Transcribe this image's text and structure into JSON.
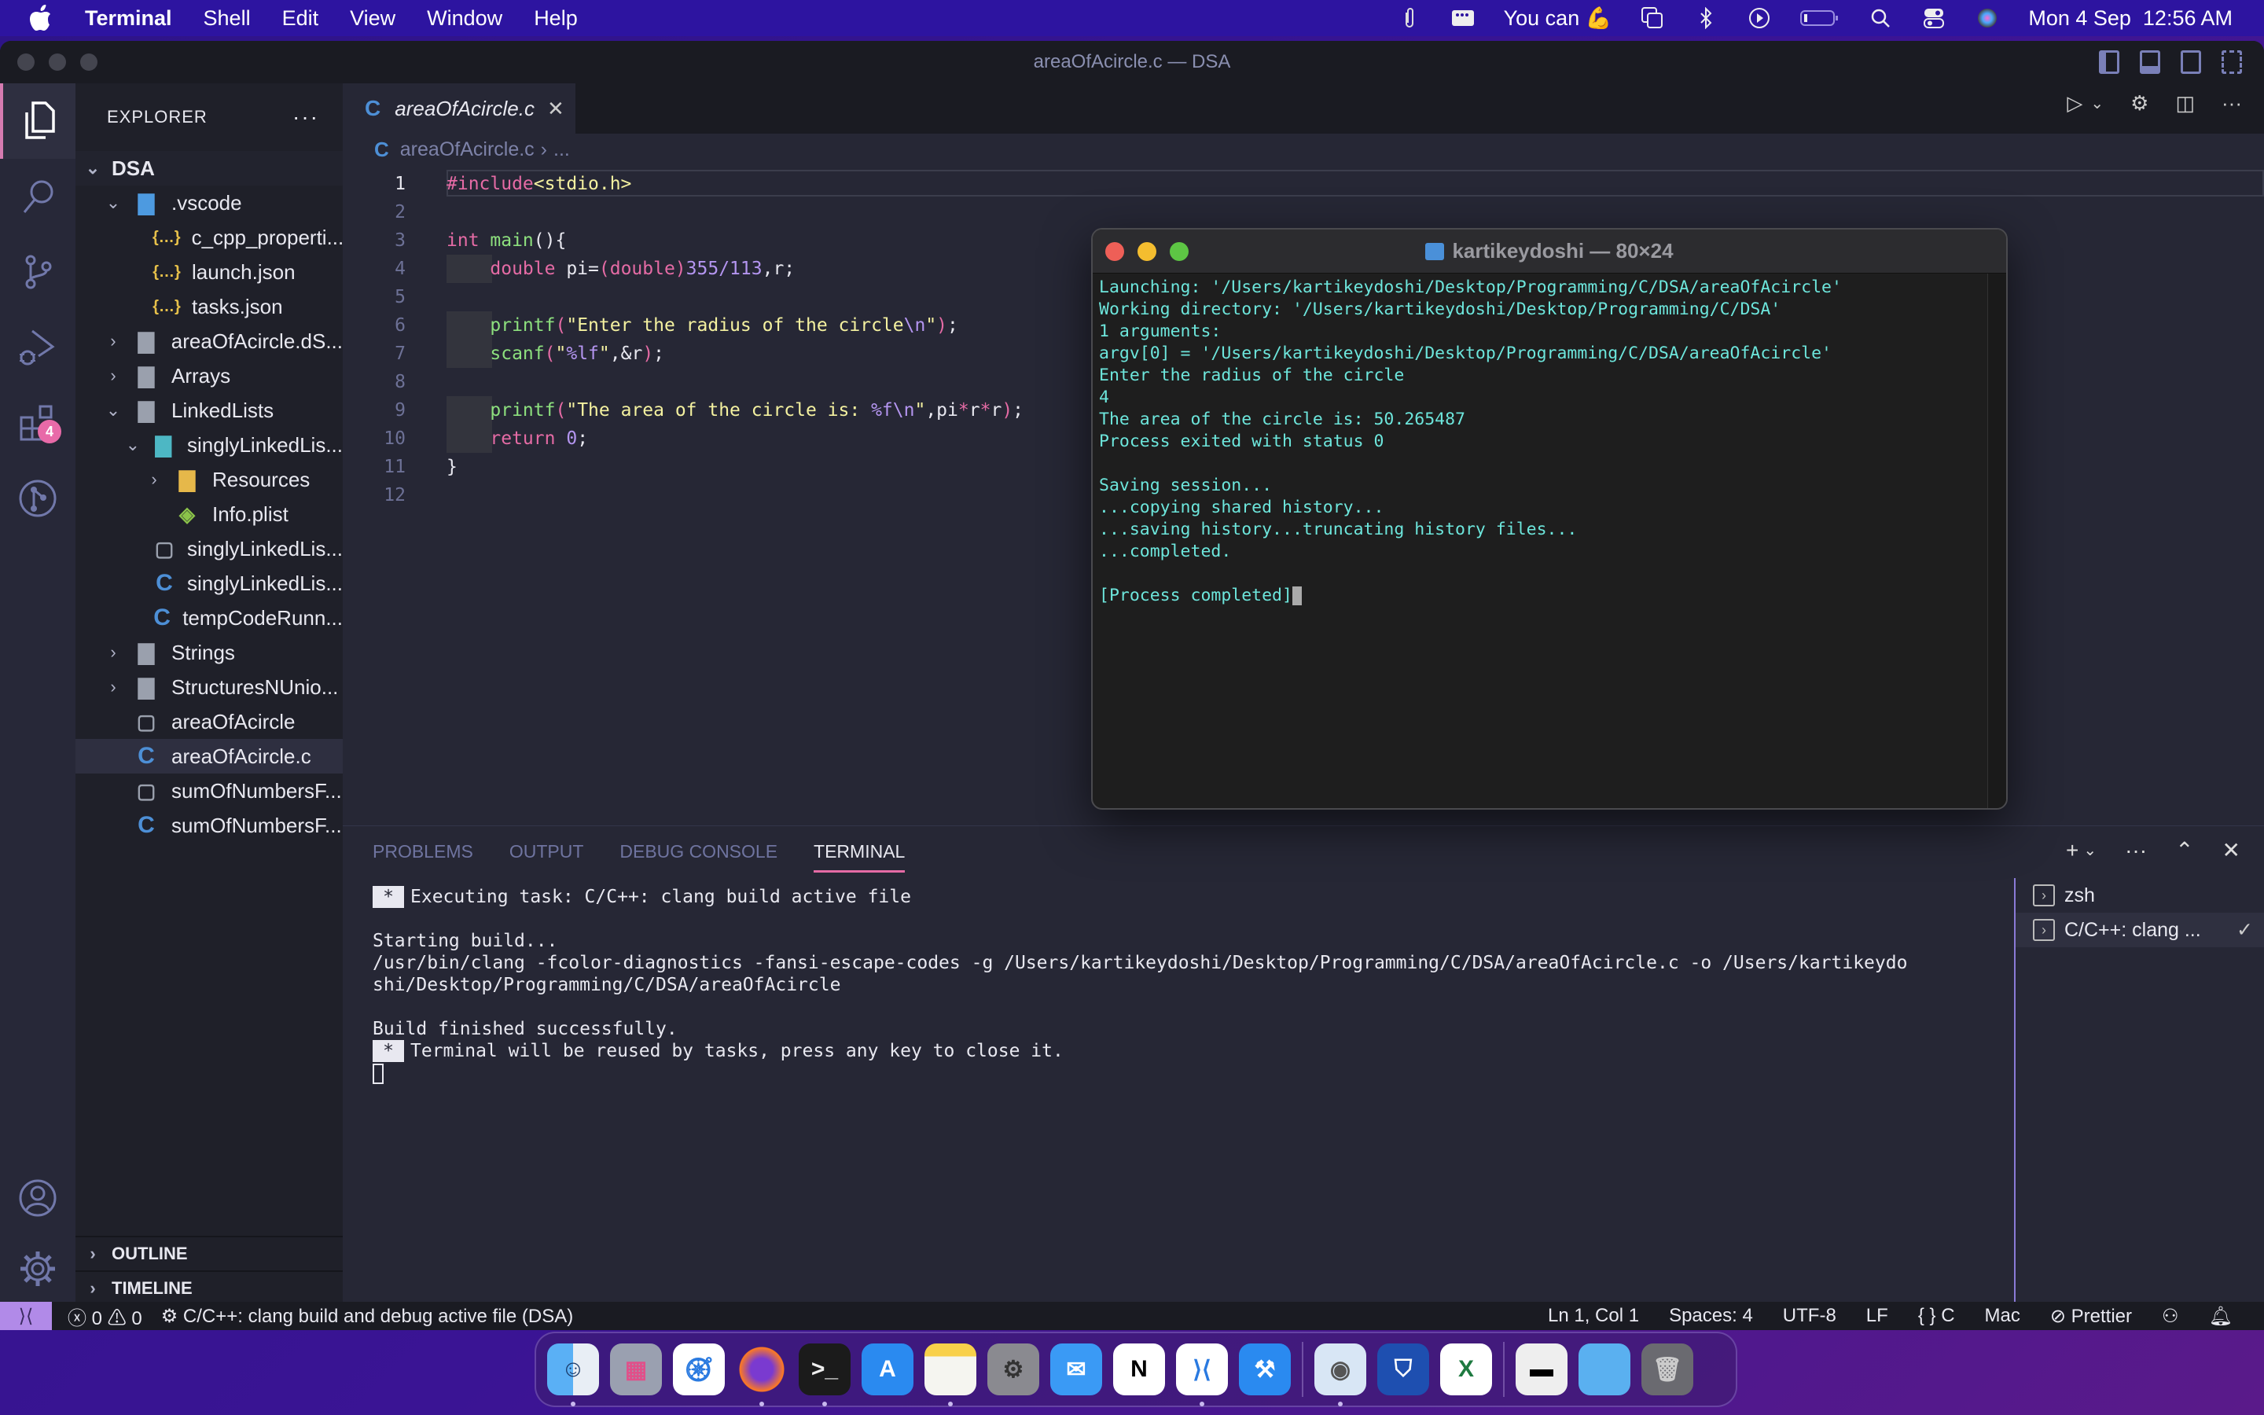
{
  "menubar": {
    "app_name": "Terminal",
    "items": [
      "Shell",
      "Edit",
      "View",
      "Window",
      "Help"
    ],
    "status_text": "You can 💪",
    "datetime": "Mon 4 Sep  12:56 AM",
    "icons": [
      "paperclip-icon",
      "menu-extra-icon",
      "screen-mirroring-icon",
      "bluetooth-icon",
      "play-icon",
      "battery-icon",
      "spotlight-search-icon",
      "control-center-icon",
      "siri-icon"
    ]
  },
  "vscode": {
    "window_title": "areaOfAcircle.c — DSA",
    "activity_bar": {
      "items": [
        "explorer",
        "search",
        "source-control",
        "run-debug",
        "extensions",
        "git-graph"
      ],
      "extensions_badge": "4",
      "bottom": [
        "accounts",
        "manage"
      ]
    },
    "explorer": {
      "title": "EXPLORER",
      "more": "···",
      "root": "DSA",
      "tree": [
        {
          "label": ".vscode",
          "type": "folder-vscode",
          "depth": 1,
          "expanded": true
        },
        {
          "label": "c_cpp_properti...",
          "type": "json",
          "depth": 2
        },
        {
          "label": "launch.json",
          "type": "json",
          "depth": 2
        },
        {
          "label": "tasks.json",
          "type": "json",
          "depth": 2
        },
        {
          "label": "areaOfAcircle.dS...",
          "type": "folder",
          "depth": 1,
          "expanded": false
        },
        {
          "label": "Arrays",
          "type": "folder",
          "depth": 1,
          "expanded": false
        },
        {
          "label": "LinkedLists",
          "type": "folder",
          "depth": 1,
          "expanded": true
        },
        {
          "label": "singlyLinkedLis...",
          "type": "folder-special",
          "depth": 2,
          "expanded": true
        },
        {
          "label": "Resources",
          "type": "folder-resources",
          "depth": 3,
          "expanded": false
        },
        {
          "label": "Info.plist",
          "type": "plist",
          "depth": 3
        },
        {
          "label": "singlyLinkedLis...",
          "type": "file",
          "depth": 2
        },
        {
          "label": "singlyLinkedLis...",
          "type": "c",
          "depth": 2
        },
        {
          "label": "tempCodeRunn...",
          "type": "c",
          "depth": 2
        },
        {
          "label": "Strings",
          "type": "folder",
          "depth": 1,
          "expanded": false
        },
        {
          "label": "StructuresNUnio...",
          "type": "folder",
          "depth": 1,
          "expanded": false
        },
        {
          "label": "areaOfAcircle",
          "type": "file",
          "depth": 1
        },
        {
          "label": "areaOfAcircle.c",
          "type": "c",
          "depth": 1,
          "selected": true
        },
        {
          "label": "sumOfNumbersF...",
          "type": "file",
          "depth": 1
        },
        {
          "label": "sumOfNumbersF...",
          "type": "c",
          "depth": 1
        }
      ],
      "sections": [
        "OUTLINE",
        "TIMELINE"
      ]
    },
    "editor": {
      "tab_label": "areaOfAcircle.c",
      "breadcrumb_file": "areaOfAcircle.c",
      "breadcrumb_more": "...",
      "lines": [
        [
          [
            "pp",
            "#include"
          ],
          [
            "str",
            "<stdio.h>"
          ]
        ],
        [],
        [
          [
            "kw",
            "int "
          ],
          [
            "fn",
            "main"
          ],
          [
            "",
            "(){"
          ]
        ],
        [
          [
            "",
            "    "
          ],
          [
            "kw",
            "double"
          ],
          [
            "",
            " pi="
          ],
          [
            "kw",
            "(double)"
          ],
          [
            "num",
            "355/113"
          ],
          [
            "",
            ",r;"
          ]
        ],
        [],
        [
          [
            "",
            "    "
          ],
          [
            "fn",
            "printf"
          ],
          [
            "kw",
            "("
          ],
          [
            "str",
            "\"Enter the radius of the circle"
          ],
          [
            "num",
            "\\n"
          ],
          [
            "str",
            "\""
          ],
          [
            "kw",
            ")"
          ],
          [
            "",
            ";"
          ]
        ],
        [
          [
            "",
            "    "
          ],
          [
            "fn",
            "scanf"
          ],
          [
            "kw",
            "("
          ],
          [
            "str",
            "\""
          ],
          [
            "num",
            "%lf"
          ],
          [
            "str",
            "\""
          ],
          [
            "",
            ",&r"
          ],
          [
            "kw",
            ")"
          ],
          [
            "",
            ";"
          ]
        ],
        [],
        [
          [
            "",
            "    "
          ],
          [
            "fn",
            "printf"
          ],
          [
            "kw",
            "("
          ],
          [
            "str",
            "\"The area of the circle is: "
          ],
          [
            "num",
            "%f\\n"
          ],
          [
            "str",
            "\""
          ],
          [
            "",
            ",pi"
          ],
          [
            "kw",
            "*"
          ],
          [
            "",
            "r"
          ],
          [
            "kw",
            "*"
          ],
          [
            "",
            "r"
          ],
          [
            "kw",
            ")"
          ],
          [
            "",
            ";"
          ]
        ],
        [
          [
            "",
            "    "
          ],
          [
            "kw",
            "return "
          ],
          [
            "num",
            "0"
          ],
          [
            "",
            ";"
          ]
        ],
        [
          [
            "",
            "}"
          ]
        ],
        []
      ]
    },
    "panel": {
      "tabs": [
        "PROBLEMS",
        "OUTPUT",
        "DEBUG CONSOLE",
        "TERMINAL"
      ],
      "active_tab": "TERMINAL",
      "terminal_lines": [
        {
          "star": true,
          "text": "Executing task: C/C++: clang build active file"
        },
        {
          "text": ""
        },
        {
          "text": "Starting build..."
        },
        {
          "text": "/usr/bin/clang -fcolor-diagnostics -fansi-escape-codes -g /Users/kartikeydoshi/Desktop/Programming/C/DSA/areaOfAcircle.c -o /Users/kartikeydo"
        },
        {
          "text": "shi/Desktop/Programming/C/DSA/areaOfAcircle"
        },
        {
          "text": ""
        },
        {
          "text": "Build finished successfully."
        },
        {
          "star": true,
          "text": "Terminal will be reused by tasks, press any key to close it."
        }
      ],
      "terminal_list": [
        {
          "label": "zsh",
          "selected": false
        },
        {
          "label": "C/C++: clang ...",
          "selected": true,
          "status": "✓"
        }
      ]
    },
    "statusbar": {
      "errors": "0",
      "warnings": "0",
      "task": "C/C++: clang build and debug active file (DSA)",
      "position": "Ln 1, Col 1",
      "indent": "Spaces: 4",
      "encoding": "UTF-8",
      "eol": "LF",
      "language": "C",
      "platform": "Mac",
      "formatter": "Prettier"
    }
  },
  "terminal_window": {
    "title": "kartikeydoshi — 80×24",
    "lines": [
      "Launching: '/Users/kartikeydoshi/Desktop/Programming/C/DSA/areaOfAcircle'",
      "Working directory: '/Users/kartikeydoshi/Desktop/Programming/C/DSA'",
      "1 arguments:",
      "argv[0] = '/Users/kartikeydoshi/Desktop/Programming/C/DSA/areaOfAcircle'",
      "Enter the radius of the circle",
      "4",
      "The area of the circle is: 50.265487",
      "Process exited with status 0",
      "",
      "Saving session...",
      "...copying shared history...",
      "...saving history...truncating history files...",
      "...completed.",
      "",
      "[Process completed]"
    ]
  },
  "dock": {
    "apps": [
      "Finder",
      "Launchpad",
      "Safari",
      "Firefox",
      "Terminal",
      "App Store",
      "Notes",
      "System Settings",
      "Mail",
      "Notion",
      "Visual Studio Code",
      "Xcode",
      "Preview",
      "Bitwarden",
      "Microsoft Excel",
      "Screenshot",
      "Downloads",
      "Trash"
    ],
    "running": [
      "Finder",
      "Firefox",
      "Terminal",
      "Notes",
      "Visual Studio Code",
      "Preview"
    ]
  }
}
